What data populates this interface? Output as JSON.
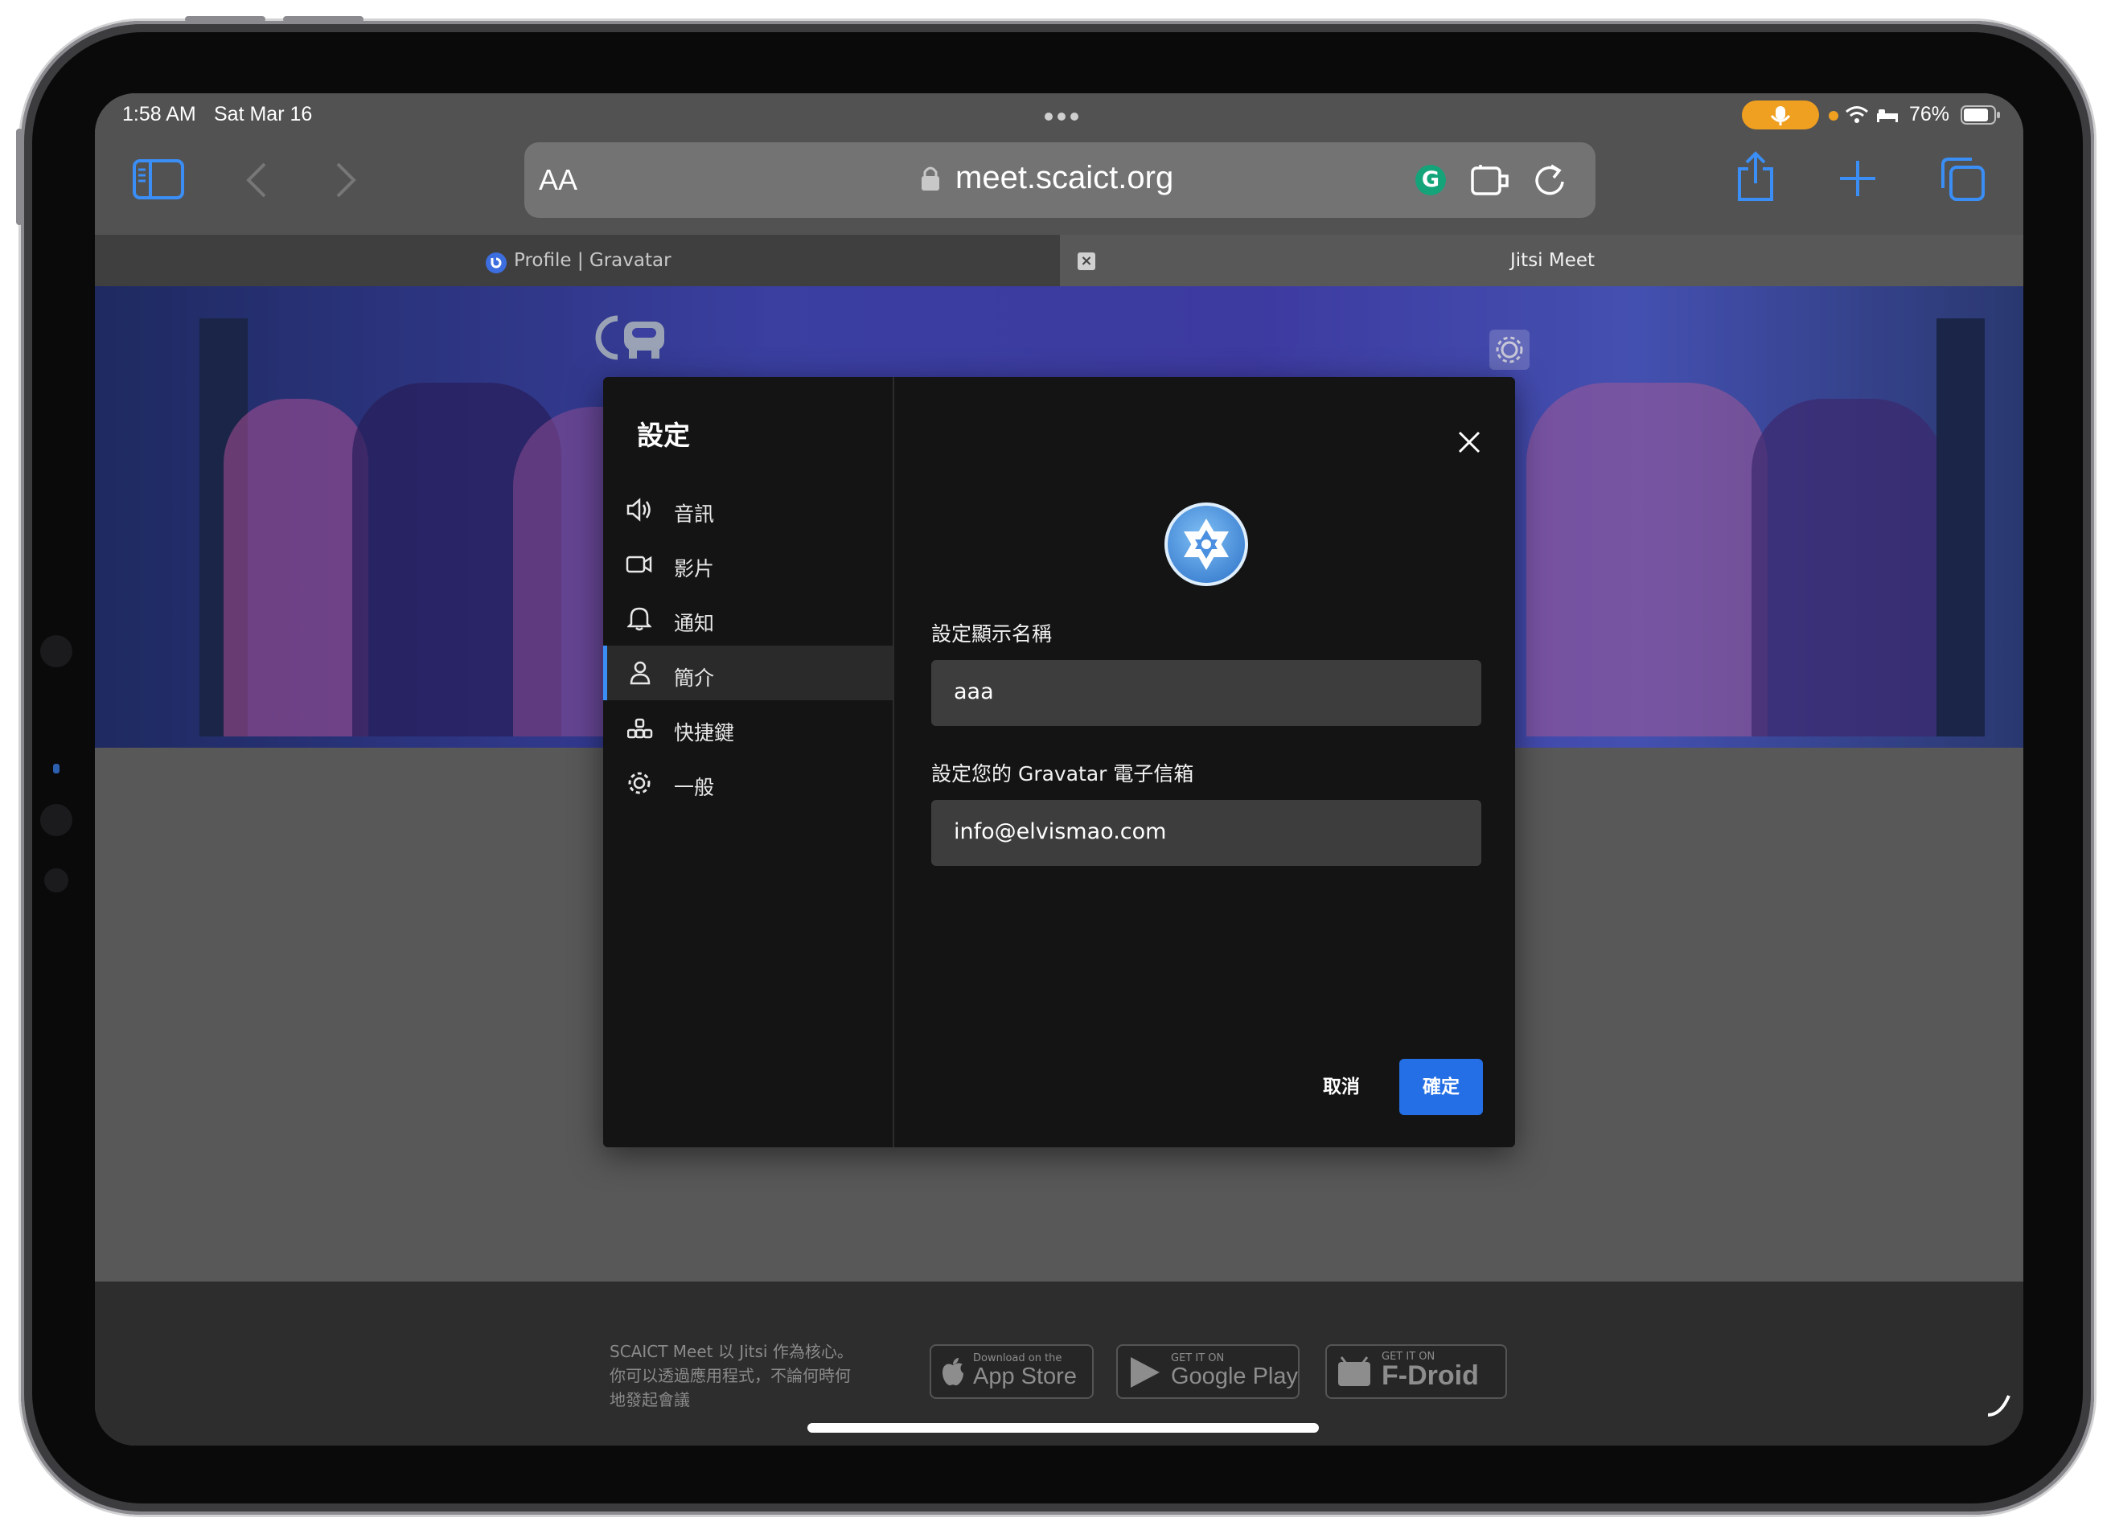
{
  "status_bar": {
    "time": "1:58 AM",
    "date": "Sat Mar 16",
    "battery_pct": "76%"
  },
  "browser": {
    "text_size_label": "AA",
    "url": "meet.scaict.org",
    "tabs": [
      {
        "label": "Profile | Gravatar",
        "active": false
      },
      {
        "label": "Jitsi Meet",
        "active": true
      }
    ]
  },
  "dialog": {
    "title": "設定",
    "nav": [
      {
        "label": "音訊",
        "icon": "speaker-icon"
      },
      {
        "label": "影片",
        "icon": "video-icon"
      },
      {
        "label": "通知",
        "icon": "bell-icon"
      },
      {
        "label": "簡介",
        "icon": "person-icon",
        "active": true
      },
      {
        "label": "快捷鍵",
        "icon": "shortcuts-icon"
      },
      {
        "label": "一般",
        "icon": "gear-icon"
      }
    ],
    "display_name_label": "設定顯示名稱",
    "display_name_value": "aaa",
    "email_label": "設定您的 Gravatar 電子信箱",
    "email_value": "info@elvismao.com",
    "cancel_label": "取消",
    "ok_label": "確定"
  },
  "footer": {
    "lines": [
      "SCAICT Meet 以 Jitsi 作為核心。",
      "你可以透過應用程式，不論何時何",
      "地發起會議"
    ],
    "badges": [
      {
        "small": "Download on the",
        "big": "App Store"
      },
      {
        "small": "GET IT ON",
        "big": "Google Play"
      },
      {
        "small": "GET IT ON",
        "big": "F-Droid"
      }
    ]
  },
  "colors": {
    "accent": "#3a8ef5",
    "primary_button": "#246fe5",
    "dialog_bg": "#141414",
    "field_bg": "#3d3d3d"
  }
}
